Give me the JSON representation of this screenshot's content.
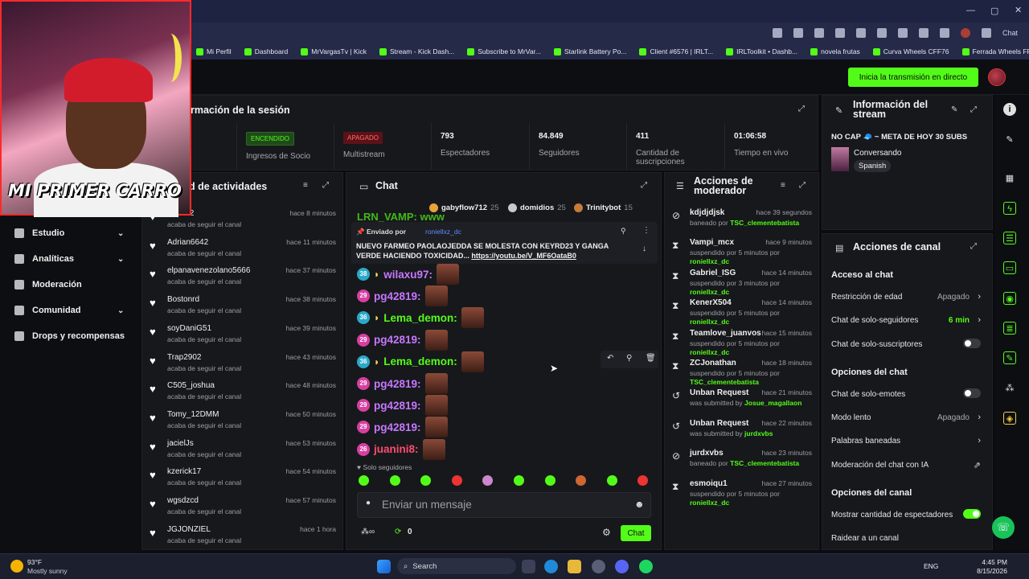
{
  "browser": {
    "copilot_label": "Chat",
    "bookmarks": [
      "Mi Perfil",
      "Dashboard",
      "MrVargasTv | Kick",
      "Stream - Kick Dash...",
      "Subscribe to MrVar...",
      "Starlink Battery Po...",
      "Client #6576 | IRLT...",
      "IRLToolkit • Dashb...",
      "novela frutas",
      "Curva Wheels CFF76",
      "Ferrada Wheels FR9"
    ]
  },
  "topbar": {
    "go_live_label": "Inicia la transmisión en directo"
  },
  "webcam": {
    "caption": "MI PRIMER CARRO"
  },
  "sidebar": {
    "items": [
      {
        "label": "Estudio",
        "has_chevron": true
      },
      {
        "label": "Analíticas",
        "has_chevron": true
      },
      {
        "label": "Moderación",
        "has_chevron": false
      },
      {
        "label": "Comunidad",
        "has_chevron": true
      },
      {
        "label": "Drops y recompensas",
        "has_chevron": false
      }
    ]
  },
  "session": {
    "title": "rmación de la sesión",
    "stats": [
      {
        "badge": "ENCENDIDO",
        "label": "Ingresos de Socio"
      },
      {
        "badge": "APAGADO",
        "label": "Multistream"
      },
      {
        "value": "793",
        "label": "Espectadores"
      },
      {
        "value": "84.849",
        "label": "Seguidores"
      },
      {
        "value": "411",
        "label": "Cantidad de suscripciones"
      },
      {
        "value": "01:06:58",
        "label": "Tiempo en vivo"
      }
    ]
  },
  "activity": {
    "title": "d de actividades",
    "items": [
      {
        "name": "rantos2",
        "sub": "acaba de seguir el canal",
        "time": "hace 8 minutos"
      },
      {
        "name": "Adrian6642",
        "sub": "acaba de seguir el canal",
        "time": "hace 11 minutos"
      },
      {
        "name": "elpanavenezolano5666",
        "sub": "acaba de seguir el canal",
        "time": "hace 37 minutos"
      },
      {
        "name": "Bostonrd",
        "sub": "acaba de seguir el canal",
        "time": "hace 38 minutos"
      },
      {
        "name": "soyDaniG51",
        "sub": "acaba de seguir el canal",
        "time": "hace 39 minutos"
      },
      {
        "name": "Trap2902",
        "sub": "acaba de seguir el canal",
        "time": "hace 43 minutos"
      },
      {
        "name": "C505_joshua",
        "sub": "acaba de seguir el canal",
        "time": "hace 48 minutos"
      },
      {
        "name": "Tomy_12DMM",
        "sub": "acaba de seguir el canal",
        "time": "hace 50 minutos"
      },
      {
        "name": "jacielJs",
        "sub": "acaba de seguir el canal",
        "time": "hace 53 minutos"
      },
      {
        "name": "kzerick17",
        "sub": "acaba de seguir el canal",
        "time": "hace 54 minutos"
      },
      {
        "name": "wgsdzcd",
        "sub": "acaba de seguir el canal",
        "time": "hace 57 minutos"
      },
      {
        "name": "JGJONZIEL",
        "sub": "acaba de seguir el canal",
        "time": "hace 1 hora"
      }
    ]
  },
  "chat": {
    "title": "Chat",
    "top_gifters": [
      {
        "name": "gabyflow712",
        "count": "25",
        "color": "#e8a33a"
      },
      {
        "name": "domidios",
        "count": "25",
        "color": "#c8c8d0"
      },
      {
        "name": "Trinitybot",
        "count": "15",
        "color": "#c77b3a"
      }
    ],
    "partial_message": "LRN_VAMP: www",
    "pinned": {
      "sent_by_label": "Enviado por",
      "sent_by_user": "roniellxz_dc",
      "text": "NUEVO FARMEO PAOLAOJEDDA SE MOLESTA CON KEYRD23 Y GANGA VERDE HACIENDO TOXICIDAD...",
      "link": "https://youtu.be/V_MF6OataB0"
    },
    "messages": [
      {
        "sub": "38",
        "user": "wilaxu97:",
        "color": "#c678ff",
        "badge_color": "#2aa9c9",
        "banana": true
      },
      {
        "sub": "29",
        "user": "pg42819:",
        "color": "#c678ff",
        "badge_color": "#d63fa0",
        "banana": false
      },
      {
        "sub": "36",
        "user": "Lema_demon:",
        "color": "#53fc18",
        "badge_color": "#2aa9c9",
        "banana": true
      },
      {
        "sub": "29",
        "user": "pg42819:",
        "color": "#c678ff",
        "badge_color": "#d63fa0",
        "banana": false
      },
      {
        "sub": "36",
        "user": "Lema_demon:",
        "color": "#53fc18",
        "badge_color": "#2aa9c9",
        "banana": true
      },
      {
        "sub": "29",
        "user": "pg42819:",
        "color": "#c678ff",
        "badge_color": "#d63fa0",
        "banana": false
      },
      {
        "sub": "29",
        "user": "pg42819:",
        "color": "#c678ff",
        "badge_color": "#d63fa0",
        "banana": false
      },
      {
        "sub": "29",
        "user": "pg42819:",
        "color": "#c678ff",
        "badge_color": "#d63fa0",
        "banana": false
      },
      {
        "sub": "26",
        "user": "juanini8:",
        "color": "#ff4d6d",
        "badge_color": "#d63fa0",
        "banana": false
      }
    ],
    "followers_only": "Solo seguidores",
    "input_placeholder": "Enviar un mensaje",
    "points": "0",
    "send_label": "Chat"
  },
  "mod_actions": {
    "title": "Acciones de moderador",
    "items": [
      {
        "icon": "ban-icon",
        "name": "kdjdjdjsk",
        "time": "hace 39 segundos",
        "desc": "baneado por",
        "by": "TSC_clementebatista",
        "line2": ""
      },
      {
        "icon": "hourglass-icon",
        "name": "Vampi_mcx",
        "time": "hace 9 minutos",
        "desc": "suspendido por 5 minutos por",
        "by": "",
        "line2": "roniellxz_dc"
      },
      {
        "icon": "hourglass-icon",
        "name": "Gabriel_ISG",
        "time": "hace 14 minutos",
        "desc": "suspendido por 3 minutos por",
        "by": "",
        "line2": "roniellxz_dc"
      },
      {
        "icon": "hourglass-icon",
        "name": "KenerX504",
        "time": "hace 14 minutos",
        "desc": "suspendido por 5 minutos por",
        "by": "",
        "line2": "roniellxz_dc"
      },
      {
        "icon": "hourglass-icon",
        "name": "Teamlove_juanvos",
        "time": "hace 15 minutos",
        "desc": "suspendido por 5 minutos por",
        "by": "",
        "line2": "roniellxz_dc"
      },
      {
        "icon": "hourglass-icon",
        "name": "ZCJonathan",
        "time": "hace 18 minutos",
        "desc": "suspendido por 5 minutos por",
        "by": "",
        "line2": "TSC_clementebatista"
      },
      {
        "icon": "history-icon",
        "name": "Unban Request",
        "time": "hace 21 minutos",
        "desc": "was submitted by",
        "by": "Josue_magallaon",
        "line2": ""
      },
      {
        "icon": "history-icon",
        "name": "Unban Request",
        "time": "hace 22 minutos",
        "desc": "was submitted by",
        "by": "jurdxvbs",
        "line2": ""
      },
      {
        "icon": "ban-icon",
        "name": "jurdxvbs",
        "time": "hace 23 minutos",
        "desc": "baneado por",
        "by": "TSC_clementebatista",
        "line2": ""
      },
      {
        "icon": "hourglass-icon",
        "name": "esmoiqu1",
        "time": "hace 27 minutos",
        "desc": "suspendido por 5 minutos por",
        "by": "",
        "line2": "roniellxz_dc"
      }
    ]
  },
  "stream_info": {
    "title": "Información del stream",
    "stream_title": "NO CAP 🧢 ~ META DE HOY 30 SUBS",
    "category": "Conversando",
    "language": "Spanish"
  },
  "channel_actions": {
    "title": "Acciones de canal",
    "chat_access": "Acceso al chat",
    "age_restriction": {
      "label": "Restricción de edad",
      "value": "Apagado"
    },
    "followers_only": {
      "label": "Chat de solo-seguidores",
      "value": "6 min"
    },
    "subs_only": {
      "label": "Chat de solo-suscriptores"
    },
    "chat_options": "Opciones del chat",
    "emotes_only": {
      "label": "Chat de solo-emotes"
    },
    "slow_mode": {
      "label": "Modo lento",
      "value": "Apagado"
    },
    "banned_words": {
      "label": "Palabras baneadas"
    },
    "ai_moderation": {
      "label": "Moderación del chat con IA"
    },
    "channel_options": "Opciones del canal",
    "show_viewers": {
      "label": "Mostrar cantidad de espectadores"
    },
    "raid": {
      "label": "Raidear a un canal"
    }
  },
  "taskbar": {
    "weather_temp": "93°F",
    "weather_desc": "Mostly sunny",
    "search_placeholder": "Search",
    "language": "ENG",
    "time": "4:45 PM",
    "date": "8/15/2026"
  }
}
